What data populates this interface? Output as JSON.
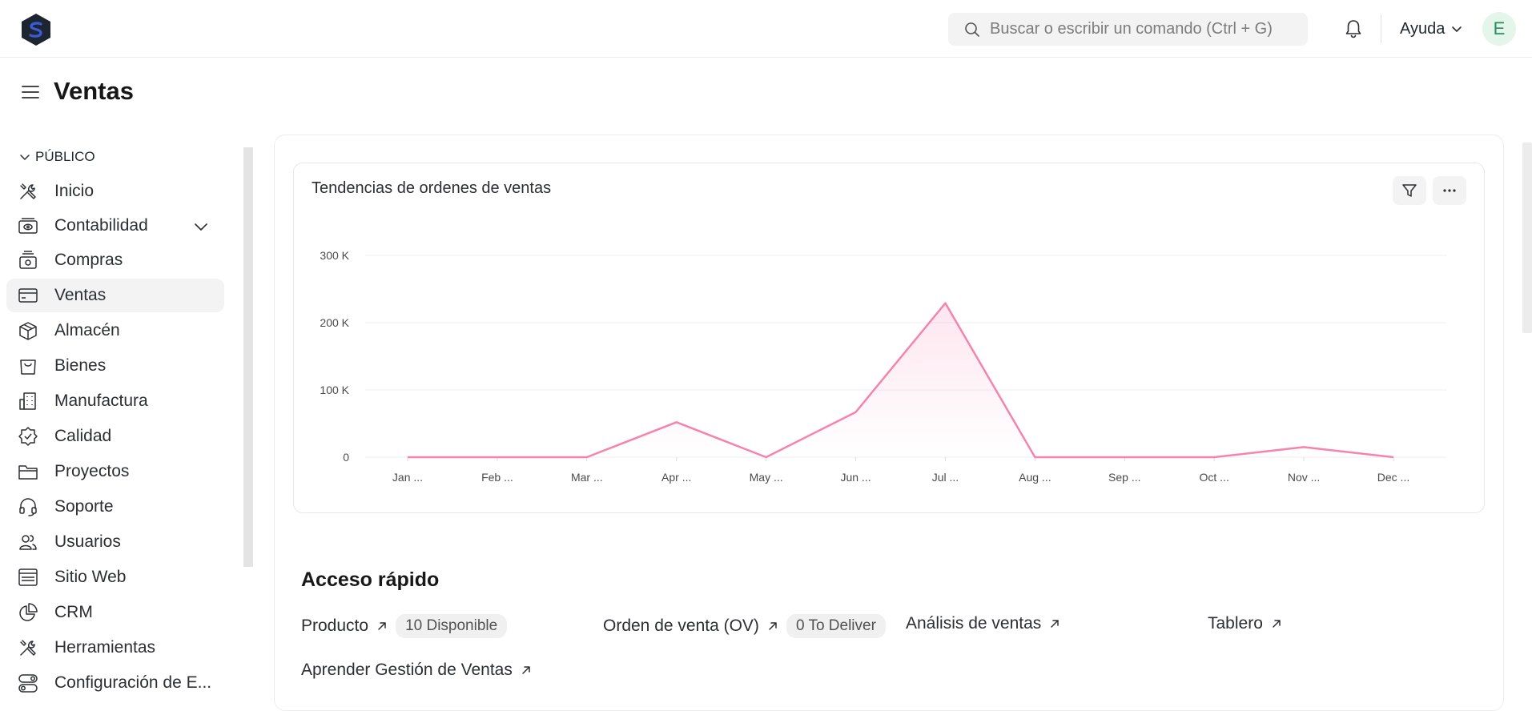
{
  "app": {
    "search_placeholder": "Buscar o escribir un comando (Ctrl + G)",
    "help_label": "Ayuda",
    "avatar_letter": "E",
    "colors": {
      "accent_pink": "#f683ae",
      "avatar_bg": "#e4f5e9",
      "avatar_fg": "#278f5e"
    }
  },
  "page": {
    "title": "Ventas"
  },
  "sidebar": {
    "section_label": "PÚBLICO",
    "items": [
      {
        "label": "Inicio",
        "icon": "tools-icon"
      },
      {
        "label": "Contabilidad",
        "icon": "accounting-icon",
        "expandable": true
      },
      {
        "label": "Compras",
        "icon": "purchase-icon"
      },
      {
        "label": "Ventas",
        "icon": "sales-icon",
        "active": true
      },
      {
        "label": "Almacén",
        "icon": "box-icon"
      },
      {
        "label": "Bienes",
        "icon": "bag-icon"
      },
      {
        "label": "Manufactura",
        "icon": "building-icon"
      },
      {
        "label": "Calidad",
        "icon": "badge-icon"
      },
      {
        "label": "Proyectos",
        "icon": "folder-icon"
      },
      {
        "label": "Soporte",
        "icon": "headset-icon"
      },
      {
        "label": "Usuarios",
        "icon": "users-icon"
      },
      {
        "label": "Sitio Web",
        "icon": "browser-icon"
      },
      {
        "label": "CRM",
        "icon": "pie-icon"
      },
      {
        "label": "Herramientas",
        "icon": "tools-icon"
      },
      {
        "label": "Configuración de E...",
        "icon": "settings-toggle-icon"
      }
    ]
  },
  "card": {
    "title": "Tendencias de ordenes de ventas"
  },
  "chart_data": {
    "type": "area",
    "title": "Tendencias de ordenes de ventas",
    "categories": [
      "Jan ...",
      "Feb ...",
      "Mar ...",
      "Apr ...",
      "May ...",
      "Jun ...",
      "Jul ...",
      "Aug ...",
      "Sep ...",
      "Oct ...",
      "Nov ...",
      "Dec ..."
    ],
    "series": [
      {
        "values": [
          0,
          0,
          0,
          52000,
          0,
          67000,
          229000,
          0,
          0,
          0,
          15000,
          0
        ],
        "color": "#f683ae"
      }
    ],
    "y_ticks": [
      0,
      100000,
      200000,
      300000
    ],
    "y_tick_labels": [
      "0",
      "100 K",
      "200 K",
      "300 K"
    ],
    "ylim": [
      0,
      300000
    ],
    "grid": true
  },
  "quick_access": {
    "title": "Acceso rápido",
    "links": [
      {
        "label": "Producto",
        "badge": "10 Disponible"
      },
      {
        "label": "Orden de venta (OV)",
        "badge": "0 To Deliver"
      },
      {
        "label": "Análisis de ventas"
      },
      {
        "label": "Tablero"
      },
      {
        "label": "Aprender Gestión de Ventas"
      }
    ]
  }
}
